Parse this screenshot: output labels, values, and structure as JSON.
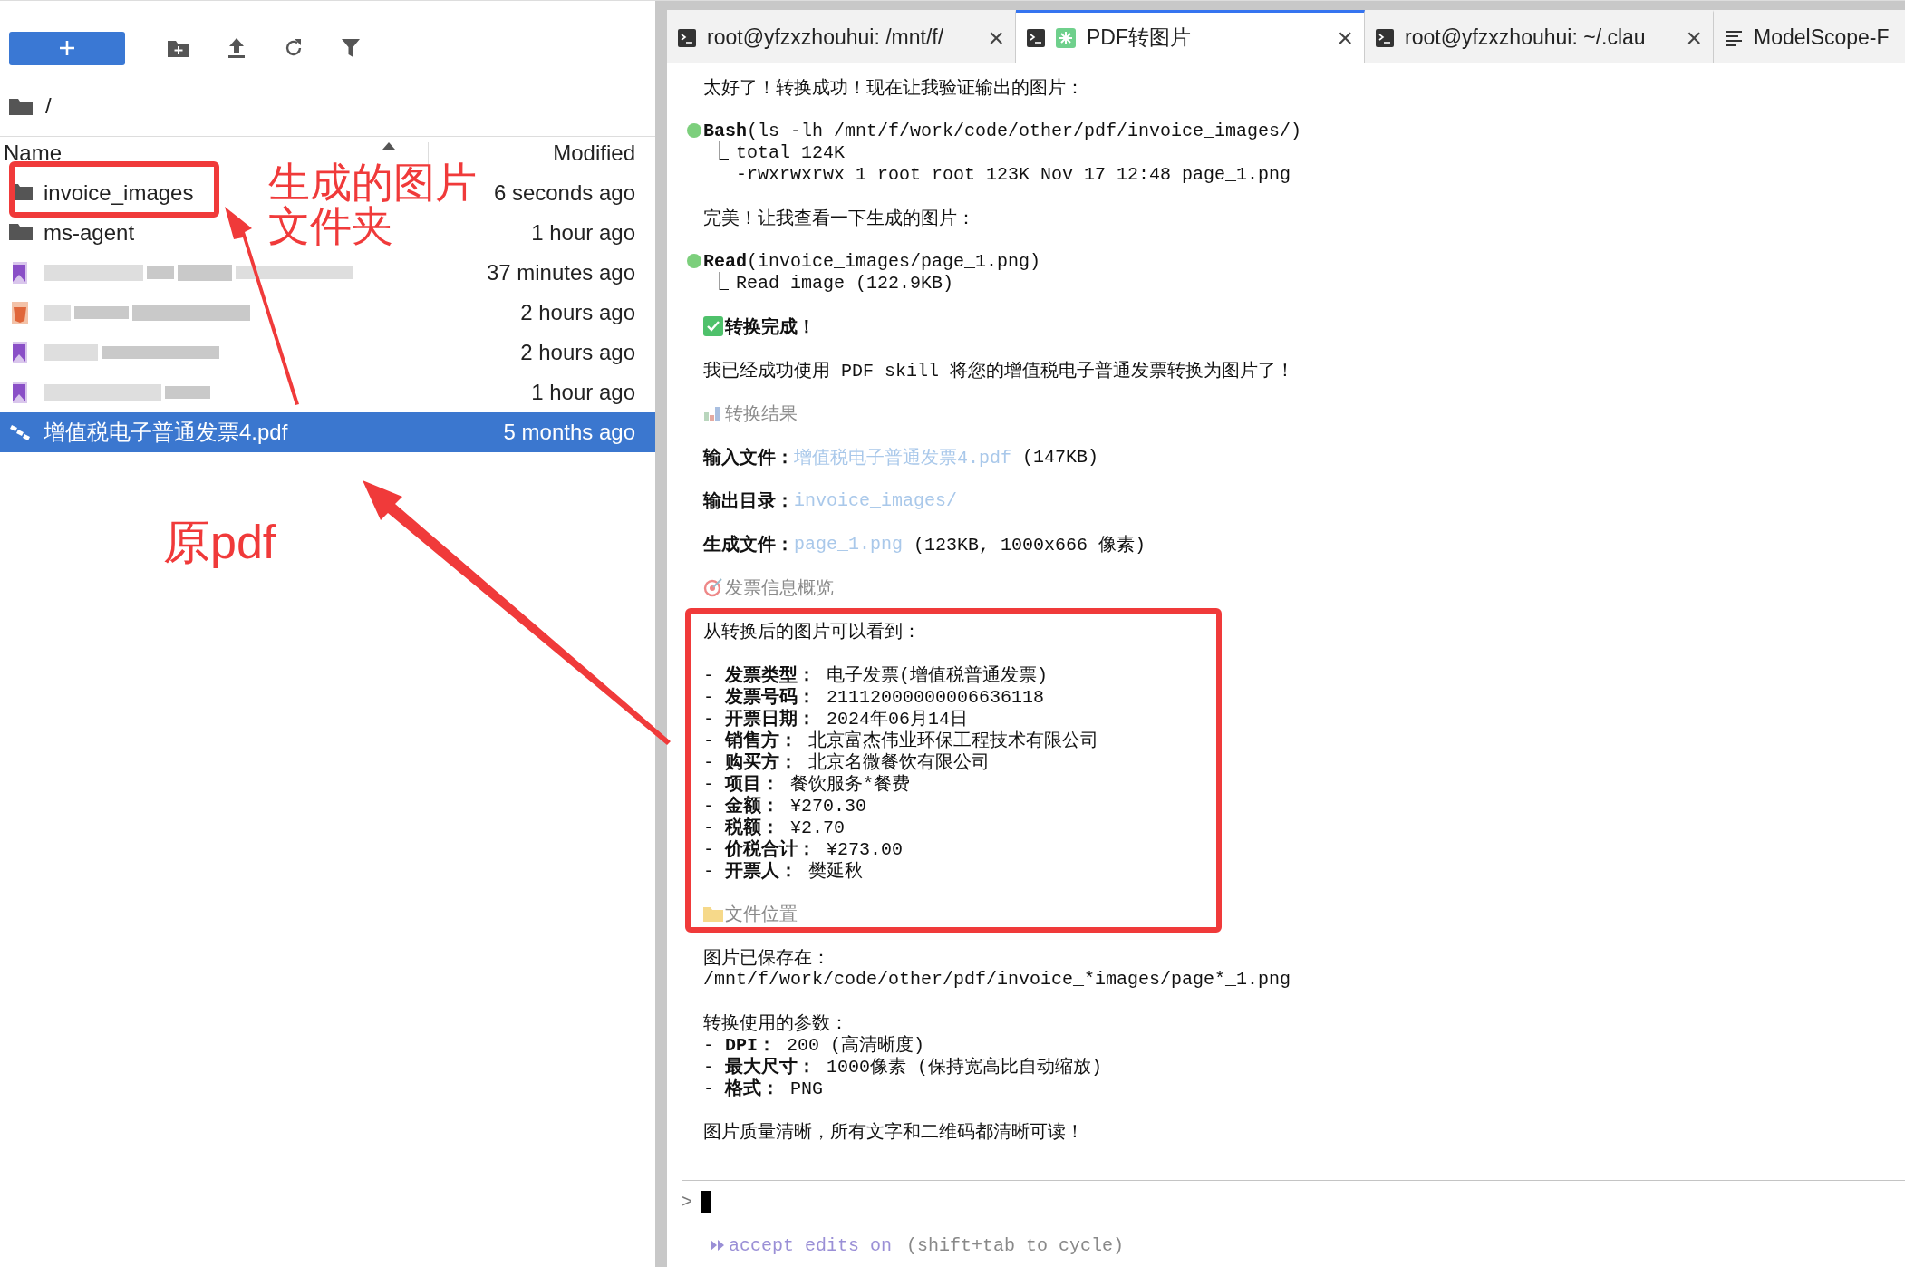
{
  "file_browser": {
    "toolbar": [
      {
        "kind": "new"
      },
      {
        "kind": "new-folder"
      },
      {
        "kind": "upload"
      },
      {
        "kind": "refresh"
      },
      {
        "kind": "filter"
      }
    ],
    "breadcrumb": "/",
    "columns": [
      {
        "label": "Name",
        "sorted": true
      },
      {
        "label": "Modified",
        "sorted": false
      }
    ],
    "rows": [
      {
        "kind": "folder",
        "name": "invoice_images",
        "modified": "6 seconds ago",
        "selected": false
      },
      {
        "kind": "folder",
        "name": "ms-agent",
        "modified": "1 hour ago",
        "selected": false
      },
      {
        "kind": "markdown",
        "modified": "37 minutes ago",
        "selected": false
      },
      {
        "kind": "html",
        "modified": "2 hours ago",
        "selected": false
      },
      {
        "kind": "markdown",
        "modified": "2 hours ago",
        "selected": false
      },
      {
        "kind": "markdown",
        "modified": "1 hour ago",
        "selected": false
      },
      {
        "kind": "pdf",
        "name": "增值税电子普通发票4.pdf",
        "modified": "5 months ago",
        "selected": true
      }
    ]
  },
  "terminal": {
    "tabs": [
      {
        "kind": "shell",
        "title": "root@yfzxzhouhui: /mnt/f/",
        "close": "×",
        "selected": false
      },
      {
        "kind": "shell",
        "busy": true,
        "title": "PDF转图片",
        "close": "×",
        "selected": true
      },
      {
        "kind": "shell",
        "title": "root@yfzxzhouhui: ~/.clau",
        "close": "×",
        "selected": false
      },
      {
        "kind": "document",
        "title": "ModelScope-F",
        "selected": false
      }
    ],
    "transcript": [
      {
        "kind": "text",
        "text": "太好了！转换成功！现在让我验证输出的图片："
      },
      {
        "kind": "tool",
        "done": true,
        "tool": "Bash",
        "args": "(ls -lh /mnt/f/work/code/other/pdf/invoice_images/)",
        "output": [
          "total 124K",
          "-rwxrwxrwx 1 root root 123K Nov 17 12:48 page_1.png"
        ],
        "connector": "⎿"
      },
      {
        "kind": "text",
        "text": "完美！让我查看一下生成的图片："
      },
      {
        "kind": "tool",
        "done": true,
        "tool": "Read",
        "args": "(invoice_images/page_1.png)",
        "output": [
          "Read image (122.9KB)"
        ],
        "connector": "⎿"
      },
      {
        "kind": "heading",
        "muted": false,
        "text": "转换完成！"
      },
      {
        "kind": "text",
        "text": "我已经成功使用 PDF skill 将您的增值税电子普通发票转换为图片了！"
      },
      {
        "kind": "heading",
        "muted": true,
        "text": "转换结果"
      },
      {
        "kind": "field",
        "label": "输入文件：",
        "link": "增值税电子普通发票4.pdf",
        "suffix": "(147KB)"
      },
      {
        "kind": "field",
        "label": "输出目录：",
        "link": "invoice_images/"
      },
      {
        "kind": "field",
        "label": "生成文件：",
        "link": "page_1.png",
        "suffix": "(123KB, 1000x666 像素)"
      },
      {
        "kind": "heading",
        "muted": true,
        "text": "发票信息概览"
      },
      {
        "kind": "text",
        "text": "从转换后的图片可以看到："
      },
      {
        "kind": "lines",
        "lines": [
          "- **发票类型：** 电子发票(增值税普通发票)",
          "- **发票号码：** 21112000000006636118",
          "- **开票日期：** 2024年06月14日",
          "- **销售方：** 北京富杰伟业环保工程技术有限公司",
          "- **购买方：** 北京名微餐饮有限公司",
          "- **项目：** 餐饮服务*餐费",
          "- **金额：** ¥270.30",
          "- **税额：** ¥2.70",
          "- **价税合计：** ¥273.00",
          "- **开票人：** 樊延秋"
        ]
      },
      {
        "kind": "heading",
        "muted": true,
        "text": "文件位置"
      },
      {
        "kind": "lines",
        "lines": [
          "图片已保存在：",
          "/mnt/f/work/code/other/pdf/invoice_*images/page*_1.png"
        ]
      },
      {
        "kind": "lines",
        "lines": [
          "转换使用的参数：",
          "- **DPI：** 200 (高清晰度)",
          "- **最大尺寸：** 1000像素 (保持宽高比自动缩放)",
          "- **格式：** PNG"
        ]
      },
      {
        "kind": "text",
        "text": "图片质量清晰，所有文字和二维码都清晰可读！"
      }
    ],
    "prompt": {
      "symbol": ">"
    },
    "mode": {
      "label": "accept edits on",
      "hint": "(shift+tab to cycle)"
    }
  },
  "annotations": [
    {
      "kind": "box"
    },
    {
      "kind": "label",
      "text": "生成的图片文件夹"
    },
    {
      "kind": "arrow"
    },
    {
      "kind": "label",
      "text": "原pdf"
    },
    {
      "kind": "arrow"
    },
    {
      "kind": "box"
    }
  ]
}
